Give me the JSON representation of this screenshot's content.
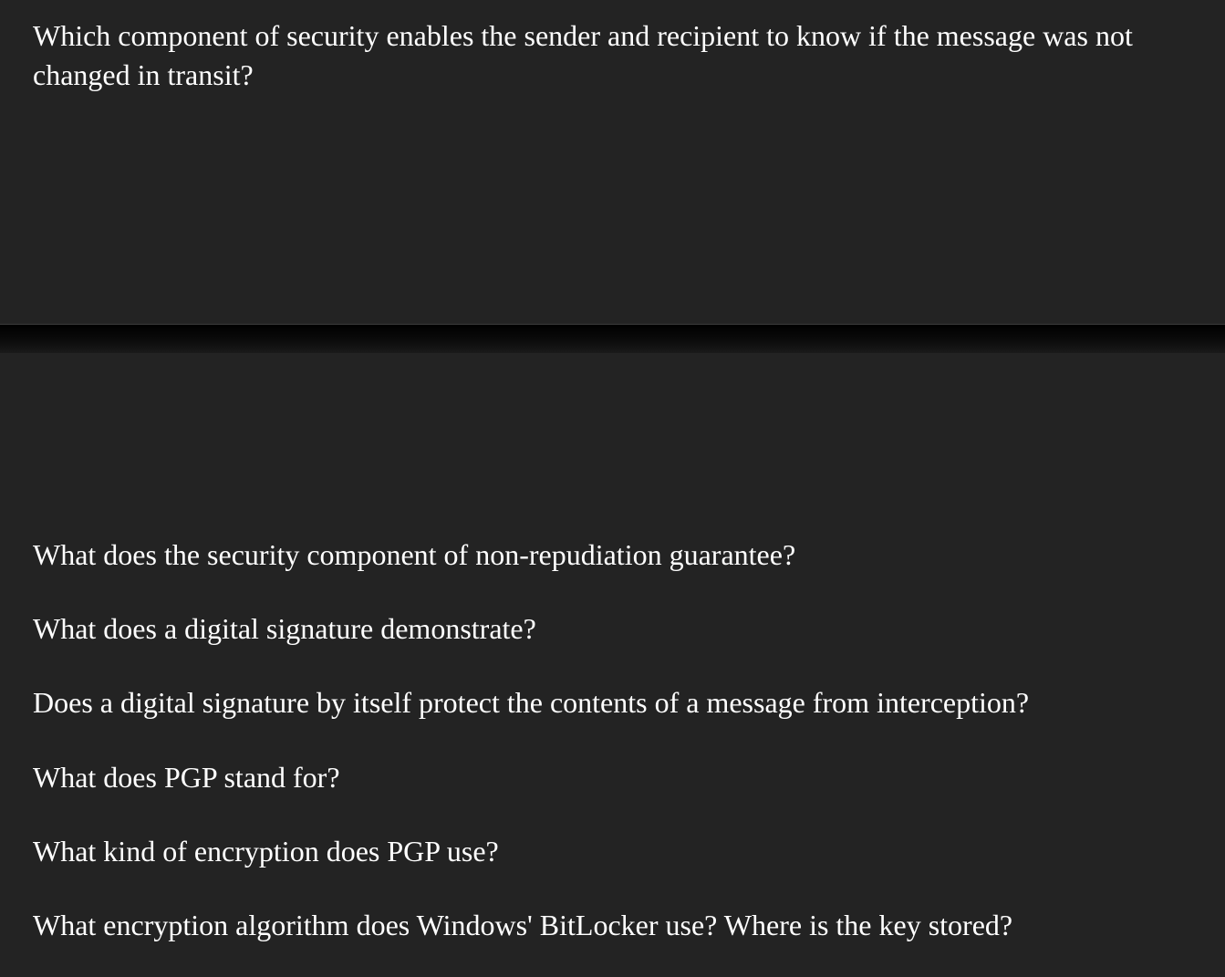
{
  "top": {
    "featured_question": "Which component of security enables the sender and recipient to know if the message was not changed in transit?"
  },
  "bottom": {
    "questions": [
      "What does the security component of non-repudiation guarantee?",
      "What does a digital signature demonstrate?",
      "Does a digital signature by itself protect the contents of a message from interception?",
      "What does PGP stand for?",
      "What kind of encryption does PGP use?",
      "What encryption algorithm does Windows' BitLocker use? Where is the key stored?"
    ]
  }
}
